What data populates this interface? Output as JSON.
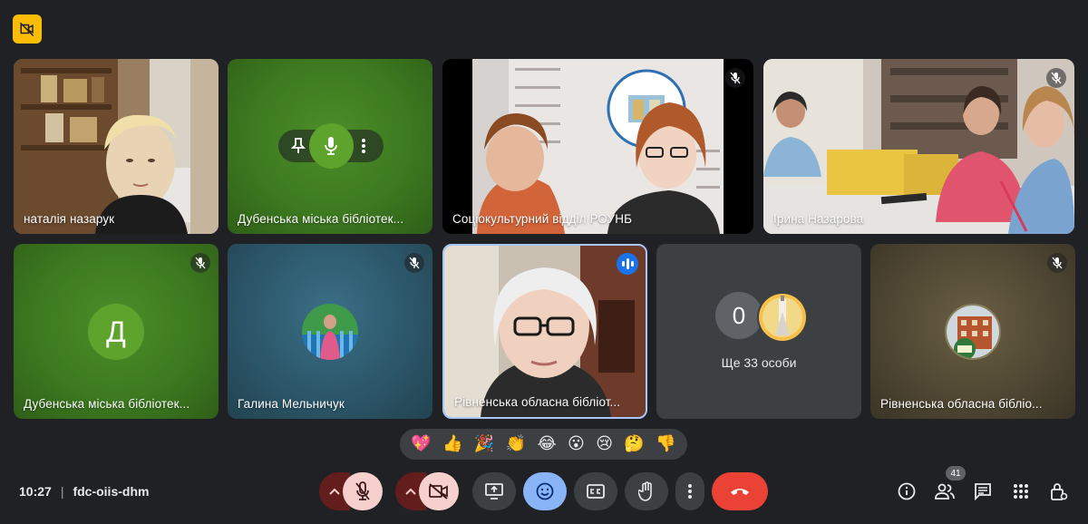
{
  "meeting": {
    "time": "10:27",
    "separator": "|",
    "code": "fdc-oiis-dhm"
  },
  "participants": [
    {
      "name": "наталія назарук"
    },
    {
      "name": "Дубенська міська бібліотек..."
    },
    {
      "name": "Соціокультурний відділ РОУНБ"
    },
    {
      "name": "Ірина Назарова"
    },
    {
      "name": "Дубенська міська бібліотек...",
      "initial": "Д"
    },
    {
      "name": "Галина Мельничук"
    },
    {
      "name": "Рівненська обласна бібліот..."
    },
    {
      "name": "Рівненська обласна бібліо..."
    }
  ],
  "more": {
    "count": "0",
    "label": "Ще 33 особи"
  },
  "reactions": [
    "💖",
    "👍",
    "🎉",
    "👏",
    "😂",
    "😮",
    "😢",
    "🤔",
    "👎"
  ],
  "people_count": "41",
  "colors": {
    "accent_yellow": "#fbbc04",
    "hangup_red": "#ea4335",
    "muted_bg": "#f6d0cd",
    "active_blue": "#8ab4f8",
    "speaking_blue": "#1a73e8"
  },
  "icons": {
    "top_badge": "no-camera-icon",
    "mic": "mic-off-icon",
    "camera": "camera-off-icon",
    "present": "present-screen-icon",
    "emoji": "emoji-icon",
    "captions": "captions-icon",
    "hand": "raise-hand-icon",
    "more": "more-vert-icon",
    "hangup": "call-end-icon",
    "info": "info-icon",
    "people": "people-icon",
    "chat": "chat-icon",
    "activities": "apps-grid-icon",
    "host": "host-controls-icon"
  }
}
